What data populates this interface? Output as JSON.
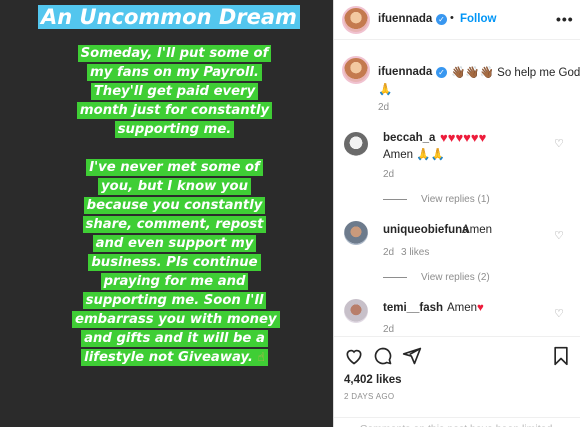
{
  "story": {
    "title": "An Uncommon Dream",
    "paragraph1": "Someday, I'll put some of my fans on my Payroll. They'll get paid every month just for constantly supporting me.",
    "paragraph2": "I've never met some of you, but I know you because you constantly share, comment, repost and even support my business. Pls continue praying for me and supporting me. Soon I'll embarrass you with money and gifts and it will be a lifestyle not Giveaway.",
    "paragraph2_end_emoji": "☝"
  },
  "header": {
    "username": "ifuennada",
    "separator": "•",
    "follow_label": "Follow",
    "more_label": "•••"
  },
  "caption": {
    "username": "ifuennada",
    "emojis": "👋🏾👋🏾👋🏾",
    "text": "So help me God",
    "emoji_end": "🙏",
    "time": "2d"
  },
  "comments": [
    {
      "username": "beccah_a",
      "text": "♥♥♥♥♥♥",
      "line2": "Amen",
      "line2_emojis": "🙏🙏",
      "time": "2d",
      "likes": "",
      "replies": "View replies (1)"
    },
    {
      "username": "uniqueobiefuna",
      "text": "Amen",
      "time": "2d",
      "likes": "3 likes",
      "replies": "View replies (2)"
    },
    {
      "username": "temi__fash",
      "text": "Amen",
      "emoji": "♥",
      "time": "2d",
      "likes": ""
    }
  ],
  "actions": {
    "likes": "4,402 likes",
    "ago": "2 DAYS AGO",
    "limited_notice": "Comments on this post have been limited."
  },
  "colors": {
    "story_bg": "#2b2b2b",
    "title_highlight": "#53c6ee",
    "body_highlight": "#3fce35",
    "follow_blue": "#0095f6",
    "verified_blue": "#3897f0",
    "heart_red": "#ed1c3b"
  },
  "icons": [
    "verified-badge-icon",
    "heart-outline-icon",
    "comment-icon",
    "share-icon",
    "bookmark-icon",
    "more-icon"
  ]
}
